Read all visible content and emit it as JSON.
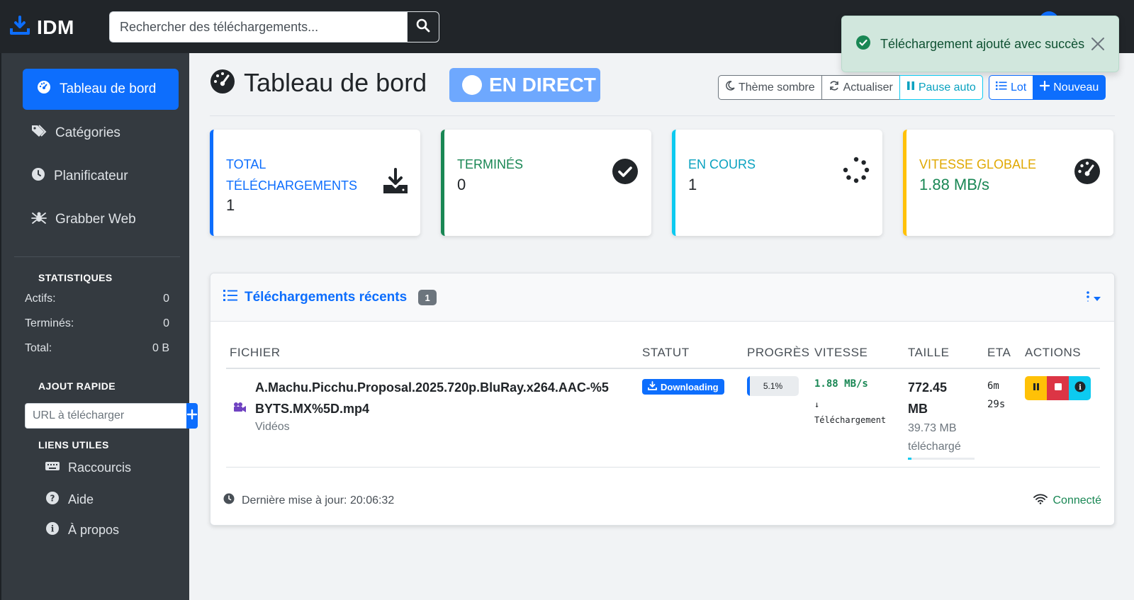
{
  "app": {
    "brand": "IDM"
  },
  "search": {
    "placeholder": "Rechercher des téléchargements..."
  },
  "toast": {
    "message": "Téléchargement ajouté avec succès"
  },
  "sidebar": {
    "items": [
      {
        "label": "Tableau de bord",
        "icon": "dashboard-icon",
        "active": true
      },
      {
        "label": "Catégories",
        "icon": "tags-icon"
      },
      {
        "label": "Planificateur",
        "icon": "clock-icon"
      },
      {
        "label": "Grabber Web",
        "icon": "spider-icon"
      }
    ],
    "stats_heading": "STATISTIQUES",
    "stats": [
      {
        "label": "Actifs:",
        "value": "0"
      },
      {
        "label": "Terminés:",
        "value": "0"
      },
      {
        "label": "Total:",
        "value": "0 B"
      }
    ],
    "quick_add_heading": "AJOUT RAPIDE",
    "quick_add_placeholder": "URL à télécharger",
    "links_heading": "LIENS UTILES",
    "links": [
      {
        "label": "Raccourcis",
        "icon": "keyboard-icon"
      },
      {
        "label": "Aide",
        "icon": "question-icon"
      },
      {
        "label": "À propos",
        "icon": "info-icon"
      }
    ]
  },
  "header": {
    "title": "Tableau de bord",
    "live_badge": "EN DIRECT",
    "buttons": {
      "dark_theme": "Thème sombre",
      "refresh": "Actualiser",
      "pause_auto": "Pause auto",
      "batch": "Lot",
      "new": "Nouveau"
    }
  },
  "cards": [
    {
      "label": "TOTAL TÉLÉCHARGEMENTS",
      "value": "1",
      "color": "#0d6efd",
      "icon": "download-icon"
    },
    {
      "label": "TERMINÉS",
      "value": "0",
      "color": "#198754",
      "icon": "check-circle-icon"
    },
    {
      "label": "EN COURS",
      "value": "1",
      "color": "#0dcaf0",
      "icon": "spinner-icon"
    },
    {
      "label": "VITESSE GLOBALE",
      "value": "1.88 MB/s",
      "color": "#ffc107",
      "icon": "speedometer-icon"
    }
  ],
  "recent": {
    "title": "Téléchargements récents",
    "count": "1",
    "columns": [
      "FICHIER",
      "STATUT",
      "PROGRÈS",
      "VITESSE",
      "TAILLE",
      "ETA",
      "ACTIONS"
    ],
    "rows": [
      {
        "file": "A.Machu.Picchu.Proposal.2025.720p.BluRay.x264.AAC-%5BYTS.MX%5D.mp4",
        "category": "Vidéos",
        "status": "Downloading",
        "progress_text": "5.1%",
        "progress": 0.051,
        "speed": "1.88 MB/s",
        "speed_arrow": "↓",
        "speed_label": "Téléchargement",
        "size": "772.45 MB",
        "downloaded": "39.73 MB téléchargé",
        "eta": "6m 29s"
      }
    ],
    "last_update": "Dernière mise à jour: 20:06:32",
    "connection": "Connecté"
  },
  "colors": {
    "primary": "#0d6efd",
    "success": "#198754",
    "info": "#0dcaf0",
    "warning": "#ffc107",
    "danger": "#dc3545",
    "sidebar_bg": "#343a40",
    "topbar_bg": "#212529"
  }
}
